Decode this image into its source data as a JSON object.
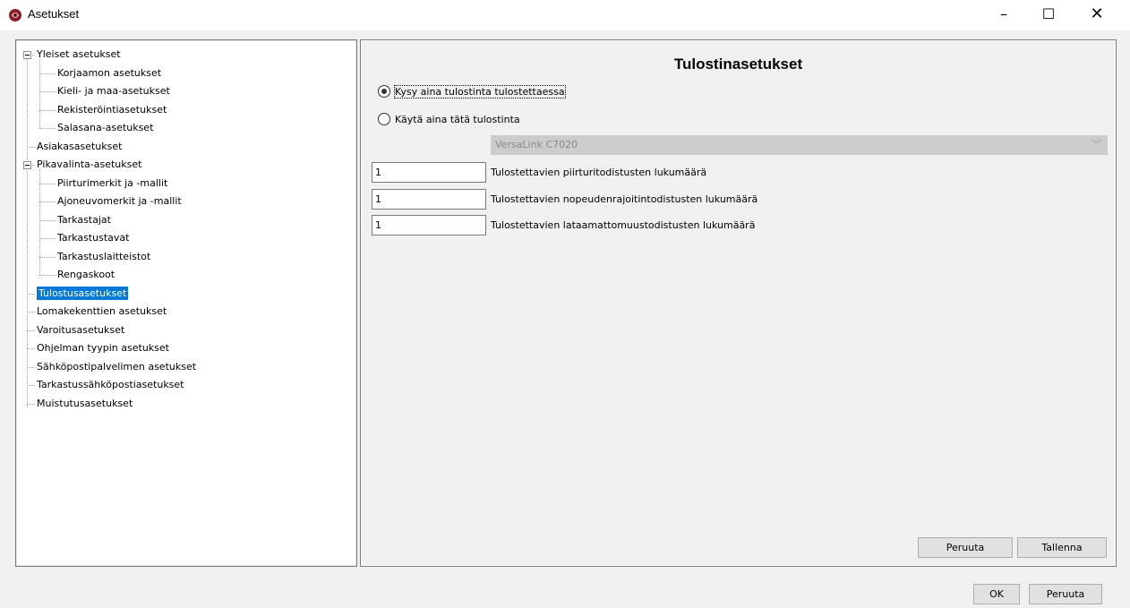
{
  "window": {
    "title": "Asetukset",
    "minimize_glyph": "–",
    "maximize_glyph": "☐",
    "close_glyph": "✕",
    "app_icon": "app-logo-icon"
  },
  "tree": {
    "items": [
      {
        "label": "Yleiset asetukset",
        "level": 0,
        "expander": true
      },
      {
        "label": "Korjaamon asetukset",
        "level": 1
      },
      {
        "label": "Kieli- ja maa-asetukset",
        "level": 1
      },
      {
        "label": "Rekisteröintiasetukset",
        "level": 1
      },
      {
        "label": "Salasana-asetukset",
        "level": 1
      },
      {
        "label": "Asiakasasetukset",
        "level": 0
      },
      {
        "label": "Pikavalinta-asetukset",
        "level": 0,
        "expander": true
      },
      {
        "label": "Piirturimerkit ja -mallit",
        "level": 1
      },
      {
        "label": "Ajoneuvomerkit ja -mallit",
        "level": 1
      },
      {
        "label": "Tarkastajat",
        "level": 1
      },
      {
        "label": "Tarkastustavat",
        "level": 1
      },
      {
        "label": "Tarkastuslaitteistot",
        "level": 1
      },
      {
        "label": "Rengaskoot",
        "level": 1
      },
      {
        "label": "Tulostusasetukset",
        "level": 0,
        "selected": true
      },
      {
        "label": "Lomakekenttien asetukset",
        "level": 0
      },
      {
        "label": "Varoitusasetukset",
        "level": 0
      },
      {
        "label": "Ohjelman tyypin asetukset",
        "level": 0
      },
      {
        "label": "Sähköpostipalvelimen asetukset",
        "level": 0
      },
      {
        "label": "Tarkastussähköpostiasetukset",
        "level": 0
      },
      {
        "label": "Muistutusasetukset",
        "level": 0
      }
    ]
  },
  "content": {
    "title": "Tulostinasetukset",
    "radio_ask": "Kysy aina tulostinta tulostettaessa",
    "radio_use": "Käytä aina tätä tulostinta",
    "printer_select": "VersaLink C7020",
    "fields": [
      {
        "value": "1",
        "label": "Tulostettavien piirturitodistusten lukumäärä"
      },
      {
        "value": "1",
        "label": "Tulostettavien nopeudenrajoitintodistusten lukumäärä"
      },
      {
        "value": "1",
        "label": "Tulostettavien lataamattomuustodistusten lukumäärä"
      }
    ],
    "cancel_label": "Peruuta",
    "save_label": "Tallenna"
  },
  "footer": {
    "ok_label": "OK",
    "cancel_label": "Peruuta"
  }
}
